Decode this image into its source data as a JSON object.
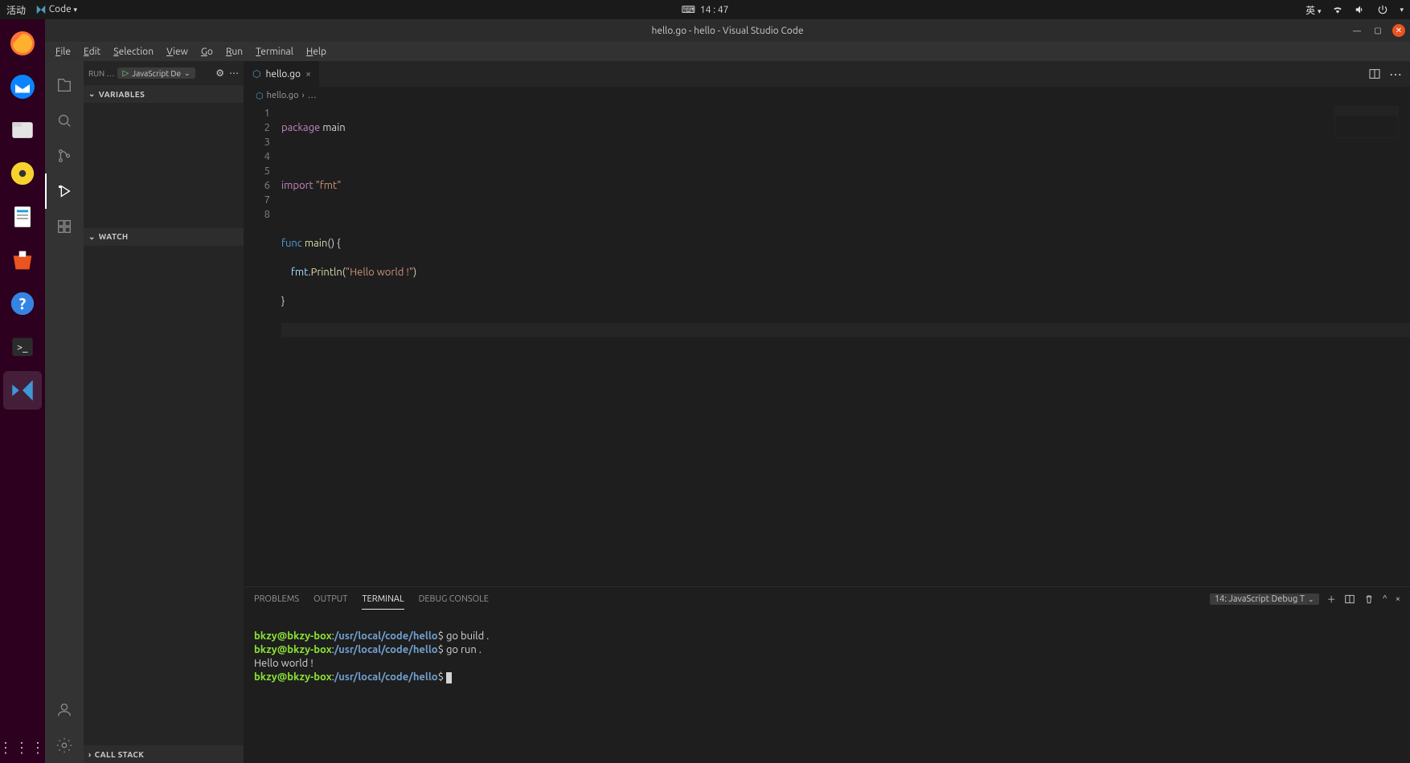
{
  "system": {
    "activity": "活动",
    "app_menu": "Code",
    "time": "14 : 47",
    "lang": "英"
  },
  "window": {
    "title": "hello.go - hello - Visual Studio Code"
  },
  "menu": {
    "file": "File",
    "edit": "Edit",
    "selection": "Selection",
    "view": "View",
    "go": "Go",
    "run": "Run",
    "terminal": "Terminal",
    "help": "Help"
  },
  "sidebar": {
    "run_label": "RUN …",
    "config": "JavaScript De",
    "sections": {
      "variables": "VARIABLES",
      "watch": "WATCH",
      "callstack": "CALL STACK"
    }
  },
  "tab": {
    "name": "hello.go"
  },
  "breadcrumb": {
    "file": "hello.go",
    "more": "…"
  },
  "code": {
    "lines": [
      "1",
      "2",
      "3",
      "4",
      "5",
      "6",
      "7",
      "8"
    ],
    "l1_kw": "package",
    "l1_id": " main",
    "l3_kw": "import",
    "l3_str": " \"fmt\"",
    "l5_kw": "func",
    "l5_fn": " main",
    "l5_rest": "() {",
    "l6_ind": "    ",
    "l6_pkg": "fmt",
    "l6_dot": ".",
    "l6_fn": "Println",
    "l6_open": "(",
    "l6_str": "\"Hello world !\"",
    "l6_close": ")",
    "l7": "}"
  },
  "panel": {
    "tabs": {
      "problems": "PROBLEMS",
      "output": "OUTPUT",
      "terminal": "TERMINAL",
      "debug": "DEBUG CONSOLE"
    },
    "selector": "14: JavaScript Debug T",
    "term": {
      "prompt_user": "bkzy@bkzy-box",
      "prompt_colon": ":",
      "prompt_path": "/usr/local/code/hello",
      "prompt_dollar": "$ ",
      "cmd1": "go build .",
      "cmd2": "go run .",
      "out1": "Hello world !"
    }
  }
}
